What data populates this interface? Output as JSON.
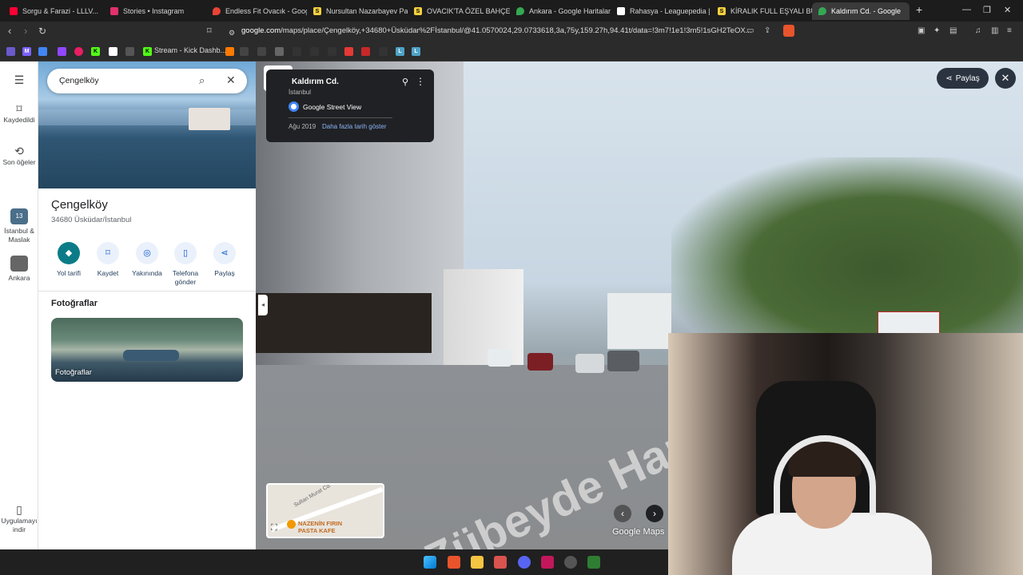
{
  "browser": {
    "tabs": [
      {
        "label": "Sorgu & Farazi - LLLV...",
        "fav_color": "#ff0033"
      },
      {
        "label": "Stories • Instagram",
        "fav_color": "#e1306c"
      },
      {
        "label": "Endless Fit Ovacık - Googl",
        "fav_color": "#ea4335"
      },
      {
        "label": "Nursultan Nazarbayev Par",
        "fav_color": "#f4d03f"
      },
      {
        "label": "OVACIK'TA ÖZEL BAHÇELİ",
        "fav_color": "#f4d03f"
      },
      {
        "label": "Ankara - Google Haritalar",
        "fav_color": "#34a853"
      },
      {
        "label": "Rahasya - Leaguepedia | L",
        "fav_color": "#ffffff"
      },
      {
        "label": "KİRALIK FULL EŞYALI BÜYÜ",
        "fav_color": "#f4d03f"
      },
      {
        "label": "Kaldırım Cd. - Google",
        "fav_color": "#34a853"
      }
    ],
    "url_domain": "google.com",
    "url_path": "/maps/place/Çengelköy,+34680+Üsküdar%2Fİstanbul/@41.0570024,29.0733618,3a,75y,159.27h,94.41t/data=!3m7!1e1!3m5!1sGH2TeOX...",
    "bookmarks_label": "Stream - Kick Dashb..."
  },
  "rail": {
    "saved": "Kaydedildi",
    "recent": "Son öğeler",
    "recent_item1": "İstanbul & Maslak",
    "recent_item2": "Ankara",
    "download": "Uygulamayı indir"
  },
  "panel": {
    "search_value": "Çengelköy",
    "title": "Çengelköy",
    "subtitle": "34680 Üsküdar/İstanbul",
    "actions": [
      "Yol tarifi",
      "Kaydet",
      "Yakınında",
      "Telefona gönder",
      "Paylaş"
    ],
    "photos_heading": "Fotoğraflar",
    "photo_label": "Fotoğraflar"
  },
  "streetview": {
    "title": "Kaldırım Cd.",
    "city": "İstanbul",
    "provider": "Google Street View",
    "date": "Ağu 2019",
    "more_dates": "Daha fazla tarih göster",
    "share": "Paylaş",
    "road_text": "Zübeyde Hanım Cd.",
    "minimap_street": "Sultan Murat Cd.",
    "minimap_poi": "NAZENİN FIRIN PASTA KAFE",
    "logo": "Google Maps"
  },
  "colors": {
    "accent": "#0b57d0",
    "primary_action": "#0b7c87"
  }
}
